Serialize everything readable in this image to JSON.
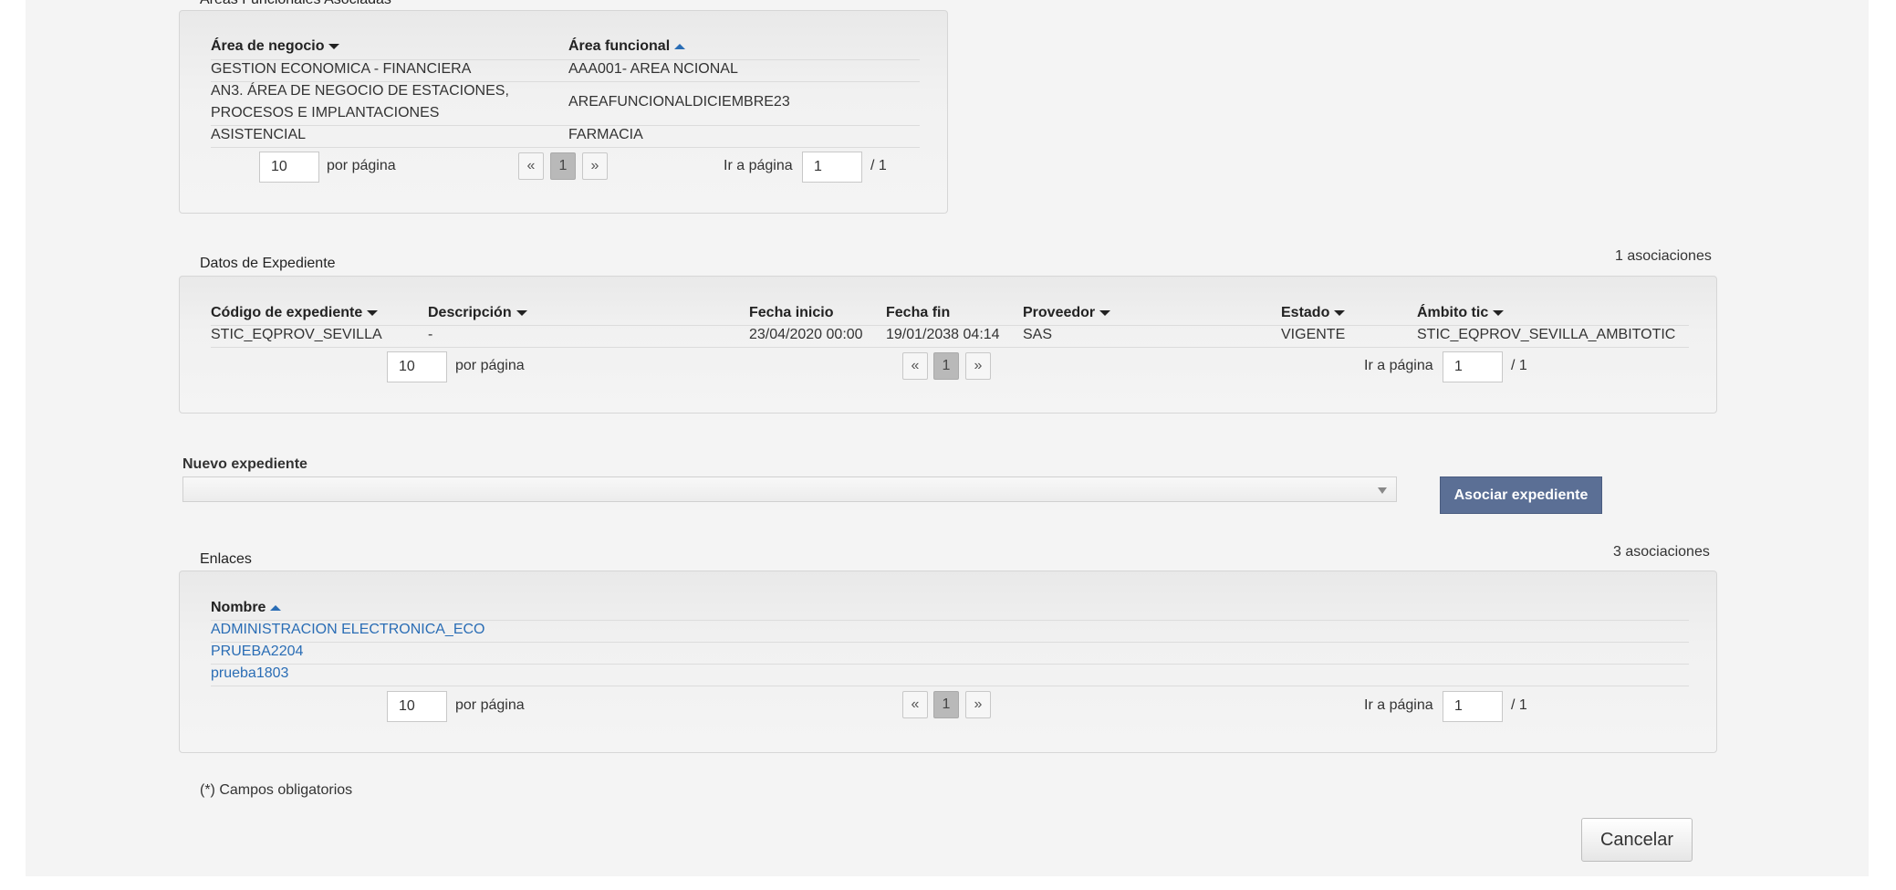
{
  "areas": {
    "title": "Áreas Funcionales Asociadas",
    "headers": {
      "area_negocio": "Área de negocio",
      "area_funcional": "Área funcional"
    },
    "rows": [
      {
        "negocio": "GESTION ECONOMICA - FINANCIERA",
        "funcional": "AAA001- AREA NCIONAL"
      },
      {
        "negocio": "AN3. ÁREA DE NEGOCIO DE ESTACIONES, PROCESOS E IMPLANTACIONES",
        "funcional": "AREAFUNCIONALDICIEMBRE23"
      },
      {
        "negocio": "ASISTENCIAL",
        "funcional": "FARMACIA"
      }
    ],
    "pagination": {
      "per_page_value": "10",
      "per_page_label": "por página",
      "prev": "«",
      "current": "1",
      "next": "»",
      "goto_label": "Ir a página",
      "goto_value": "1",
      "total": "/ 1"
    }
  },
  "expedientes": {
    "title": "Datos de Expediente",
    "count": "1 asociaciones",
    "headers": {
      "codigo": "Código de expediente",
      "descripcion": "Descripción",
      "fecha_inicio": "Fecha inicio",
      "fecha_fin": "Fecha fin",
      "proveedor": "Proveedor",
      "estado": "Estado",
      "ambito": "Ámbito tic"
    },
    "rows": [
      {
        "codigo": "STIC_EQPROV_SEVILLA",
        "descripcion": "-",
        "fecha_inicio": "23/04/2020 00:00",
        "fecha_fin": "19/01/2038 04:14",
        "proveedor": "SAS",
        "estado": "VIGENTE",
        "ambito": "STIC_EQPROV_SEVILLA_AMBITOTIC"
      }
    ],
    "pagination": {
      "per_page_value": "10",
      "per_page_label": "por página",
      "prev": "«",
      "current": "1",
      "next": "»",
      "goto_label": "Ir a página",
      "goto_value": "1",
      "total": "/ 1"
    }
  },
  "nuevo": {
    "label": "Nuevo expediente",
    "select_value": "",
    "button": "Asociar expediente"
  },
  "enlaces": {
    "title": "Enlaces",
    "count": "3 asociaciones",
    "headers": {
      "nombre": "Nombre"
    },
    "rows": [
      {
        "nombre": "ADMINISTRACION ELECTRONICA_ECO"
      },
      {
        "nombre": "PRUEBA2204"
      },
      {
        "nombre": "prueba1803"
      }
    ],
    "pagination": {
      "per_page_value": "10",
      "per_page_label": "por página",
      "prev": "«",
      "current": "1",
      "next": "»",
      "goto_label": "Ir a página",
      "goto_value": "1",
      "total": "/ 1"
    }
  },
  "footer": {
    "required_note": "(*) Campos obligatorios",
    "cancel": "Cancelar"
  },
  "colors": {
    "accent": "#5b6f95",
    "link": "#2a6db5",
    "background": "#f4f4f4"
  }
}
